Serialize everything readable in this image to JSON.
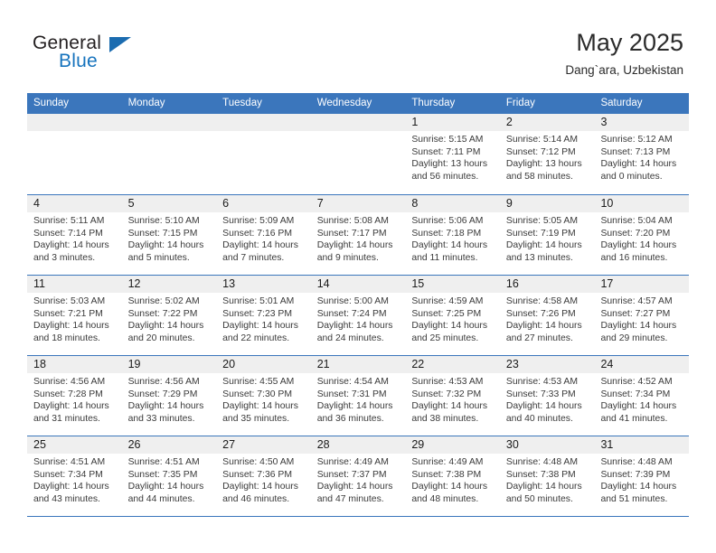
{
  "brand": {
    "name_part1": "General",
    "name_part2": "Blue",
    "accent_color": "#1673bd",
    "triangle_color": "#1b6cb0"
  },
  "header": {
    "title": "May 2025",
    "subtitle": "Dang`ara, Uzbekistan"
  },
  "calendar": {
    "header_bg": "#3b76bc",
    "weekdays": [
      "Sunday",
      "Monday",
      "Tuesday",
      "Wednesday",
      "Thursday",
      "Friday",
      "Saturday"
    ],
    "weeks": [
      [
        {
          "day": "",
          "sunrise": "",
          "sunset": "",
          "daylight": "",
          "empty": true
        },
        {
          "day": "",
          "sunrise": "",
          "sunset": "",
          "daylight": "",
          "empty": true
        },
        {
          "day": "",
          "sunrise": "",
          "sunset": "",
          "daylight": "",
          "empty": true
        },
        {
          "day": "",
          "sunrise": "",
          "sunset": "",
          "daylight": "",
          "empty": true
        },
        {
          "day": "1",
          "sunrise": "Sunrise: 5:15 AM",
          "sunset": "Sunset: 7:11 PM",
          "daylight": "Daylight: 13 hours and 56 minutes."
        },
        {
          "day": "2",
          "sunrise": "Sunrise: 5:14 AM",
          "sunset": "Sunset: 7:12 PM",
          "daylight": "Daylight: 13 hours and 58 minutes."
        },
        {
          "day": "3",
          "sunrise": "Sunrise: 5:12 AM",
          "sunset": "Sunset: 7:13 PM",
          "daylight": "Daylight: 14 hours and 0 minutes."
        }
      ],
      [
        {
          "day": "4",
          "sunrise": "Sunrise: 5:11 AM",
          "sunset": "Sunset: 7:14 PM",
          "daylight": "Daylight: 14 hours and 3 minutes."
        },
        {
          "day": "5",
          "sunrise": "Sunrise: 5:10 AM",
          "sunset": "Sunset: 7:15 PM",
          "daylight": "Daylight: 14 hours and 5 minutes."
        },
        {
          "day": "6",
          "sunrise": "Sunrise: 5:09 AM",
          "sunset": "Sunset: 7:16 PM",
          "daylight": "Daylight: 14 hours and 7 minutes."
        },
        {
          "day": "7",
          "sunrise": "Sunrise: 5:08 AM",
          "sunset": "Sunset: 7:17 PM",
          "daylight": "Daylight: 14 hours and 9 minutes."
        },
        {
          "day": "8",
          "sunrise": "Sunrise: 5:06 AM",
          "sunset": "Sunset: 7:18 PM",
          "daylight": "Daylight: 14 hours and 11 minutes."
        },
        {
          "day": "9",
          "sunrise": "Sunrise: 5:05 AM",
          "sunset": "Sunset: 7:19 PM",
          "daylight": "Daylight: 14 hours and 13 minutes."
        },
        {
          "day": "10",
          "sunrise": "Sunrise: 5:04 AM",
          "sunset": "Sunset: 7:20 PM",
          "daylight": "Daylight: 14 hours and 16 minutes."
        }
      ],
      [
        {
          "day": "11",
          "sunrise": "Sunrise: 5:03 AM",
          "sunset": "Sunset: 7:21 PM",
          "daylight": "Daylight: 14 hours and 18 minutes."
        },
        {
          "day": "12",
          "sunrise": "Sunrise: 5:02 AM",
          "sunset": "Sunset: 7:22 PM",
          "daylight": "Daylight: 14 hours and 20 minutes."
        },
        {
          "day": "13",
          "sunrise": "Sunrise: 5:01 AM",
          "sunset": "Sunset: 7:23 PM",
          "daylight": "Daylight: 14 hours and 22 minutes."
        },
        {
          "day": "14",
          "sunrise": "Sunrise: 5:00 AM",
          "sunset": "Sunset: 7:24 PM",
          "daylight": "Daylight: 14 hours and 24 minutes."
        },
        {
          "day": "15",
          "sunrise": "Sunrise: 4:59 AM",
          "sunset": "Sunset: 7:25 PM",
          "daylight": "Daylight: 14 hours and 25 minutes."
        },
        {
          "day": "16",
          "sunrise": "Sunrise: 4:58 AM",
          "sunset": "Sunset: 7:26 PM",
          "daylight": "Daylight: 14 hours and 27 minutes."
        },
        {
          "day": "17",
          "sunrise": "Sunrise: 4:57 AM",
          "sunset": "Sunset: 7:27 PM",
          "daylight": "Daylight: 14 hours and 29 minutes."
        }
      ],
      [
        {
          "day": "18",
          "sunrise": "Sunrise: 4:56 AM",
          "sunset": "Sunset: 7:28 PM",
          "daylight": "Daylight: 14 hours and 31 minutes."
        },
        {
          "day": "19",
          "sunrise": "Sunrise: 4:56 AM",
          "sunset": "Sunset: 7:29 PM",
          "daylight": "Daylight: 14 hours and 33 minutes."
        },
        {
          "day": "20",
          "sunrise": "Sunrise: 4:55 AM",
          "sunset": "Sunset: 7:30 PM",
          "daylight": "Daylight: 14 hours and 35 minutes."
        },
        {
          "day": "21",
          "sunrise": "Sunrise: 4:54 AM",
          "sunset": "Sunset: 7:31 PM",
          "daylight": "Daylight: 14 hours and 36 minutes."
        },
        {
          "day": "22",
          "sunrise": "Sunrise: 4:53 AM",
          "sunset": "Sunset: 7:32 PM",
          "daylight": "Daylight: 14 hours and 38 minutes."
        },
        {
          "day": "23",
          "sunrise": "Sunrise: 4:53 AM",
          "sunset": "Sunset: 7:33 PM",
          "daylight": "Daylight: 14 hours and 40 minutes."
        },
        {
          "day": "24",
          "sunrise": "Sunrise: 4:52 AM",
          "sunset": "Sunset: 7:34 PM",
          "daylight": "Daylight: 14 hours and 41 minutes."
        }
      ],
      [
        {
          "day": "25",
          "sunrise": "Sunrise: 4:51 AM",
          "sunset": "Sunset: 7:34 PM",
          "daylight": "Daylight: 14 hours and 43 minutes."
        },
        {
          "day": "26",
          "sunrise": "Sunrise: 4:51 AM",
          "sunset": "Sunset: 7:35 PM",
          "daylight": "Daylight: 14 hours and 44 minutes."
        },
        {
          "day": "27",
          "sunrise": "Sunrise: 4:50 AM",
          "sunset": "Sunset: 7:36 PM",
          "daylight": "Daylight: 14 hours and 46 minutes."
        },
        {
          "day": "28",
          "sunrise": "Sunrise: 4:49 AM",
          "sunset": "Sunset: 7:37 PM",
          "daylight": "Daylight: 14 hours and 47 minutes."
        },
        {
          "day": "29",
          "sunrise": "Sunrise: 4:49 AM",
          "sunset": "Sunset: 7:38 PM",
          "daylight": "Daylight: 14 hours and 48 minutes."
        },
        {
          "day": "30",
          "sunrise": "Sunrise: 4:48 AM",
          "sunset": "Sunset: 7:38 PM",
          "daylight": "Daylight: 14 hours and 50 minutes."
        },
        {
          "day": "31",
          "sunrise": "Sunrise: 4:48 AM",
          "sunset": "Sunset: 7:39 PM",
          "daylight": "Daylight: 14 hours and 51 minutes."
        }
      ]
    ]
  }
}
